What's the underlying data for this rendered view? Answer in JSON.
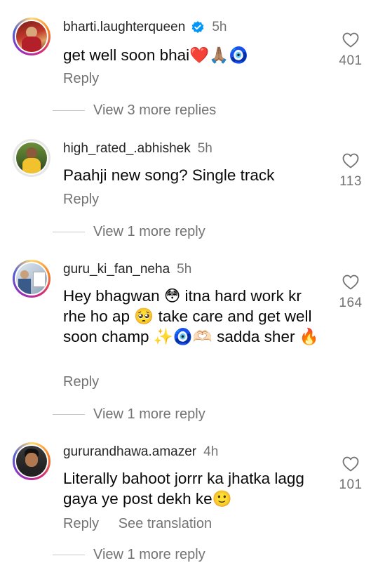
{
  "colors": {
    "text_primary": "#0a0a0a",
    "text_secondary": "#737373",
    "verified_blue": "#0095f6",
    "divider": "#c7c7c7"
  },
  "comments": [
    {
      "username": "bharti.laughterqueen",
      "verified": true,
      "time": "5h",
      "text": "get well soon bhai❤️🙏🏽🧿",
      "reply_label": "Reply",
      "likes": "401",
      "view_more": "View 3 more replies",
      "avatar_icon": "avatar-photo"
    },
    {
      "username": "high_rated_.abhishek",
      "verified": false,
      "time": "5h",
      "text": "Paahji new song? Single track",
      "reply_label": "Reply",
      "likes": "113",
      "view_more": "View 1 more reply",
      "avatar_icon": "avatar-photo"
    },
    {
      "username": "guru_ki_fan_neha",
      "verified": false,
      "time": "5h",
      "text": "Hey bhagwan 😳 itna hard work kr rhe ho ap 🥺 take care and get well soon champ ✨🧿🫶🏻 sadda sher 🔥",
      "reply_label": "Reply",
      "likes": "164",
      "view_more": "View 1 more reply",
      "avatar_icon": "avatar-photo"
    },
    {
      "username": "gururandhawa.amazer",
      "verified": false,
      "time": "4h",
      "text": "Literally bahoot jorrr ka jhatka lagg gaya ye post dekh ke🙂",
      "reply_label": "Reply",
      "translate_label": "See translation",
      "likes": "101",
      "view_more": "View 1 more reply",
      "avatar_icon": "avatar-photo"
    }
  ]
}
